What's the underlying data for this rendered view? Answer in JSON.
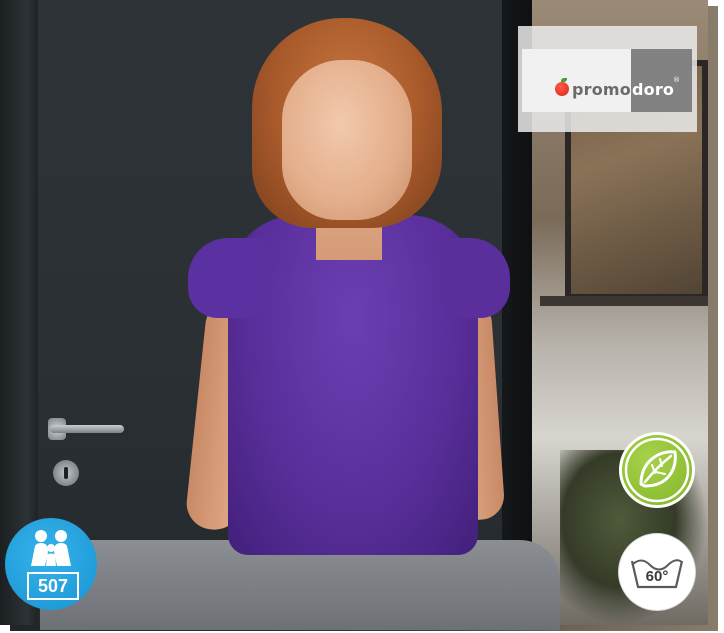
{
  "brand": {
    "name_part1": "promo",
    "name_part2": "doro",
    "registered": "®"
  },
  "badges": {
    "eco_icon": "leaf-icon",
    "wash_temperature": "60°",
    "wash_icon": "wash-tub-icon",
    "people_icon": "family-icon",
    "people_number": "507"
  },
  "colors": {
    "shirt": "#5a2f9c",
    "eco_badge": "#80b328",
    "people_badge": "#1893d3",
    "logo_grey": "#828282"
  }
}
